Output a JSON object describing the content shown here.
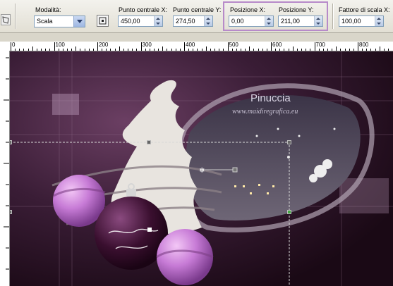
{
  "toolbar": {
    "mode_label": "Modalità:",
    "mode_value": "Scala",
    "center_x_label": "Punto centrale X:",
    "center_x_value": "450,00",
    "center_y_label": "Punto centrale Y:",
    "center_y_value": "274,50",
    "pos_x_label": "Posizione X:",
    "pos_x_value": "0,00",
    "pos_y_label": "Posizione Y:",
    "pos_y_value": "211,00",
    "scale_label": "Fattore di scala X:",
    "scale_value": "100,00",
    "highlight_color": "#b78ac9"
  },
  "ruler": {
    "labels": [
      "0",
      "100",
      "200",
      "300",
      "400",
      "500",
      "600",
      "700",
      "800"
    ]
  },
  "canvas": {
    "watermark_title": "Pinuccia",
    "watermark_url": "www.maidiregrafica.eu",
    "background_color": "#24101f",
    "accent_color": "#c77bd6"
  }
}
